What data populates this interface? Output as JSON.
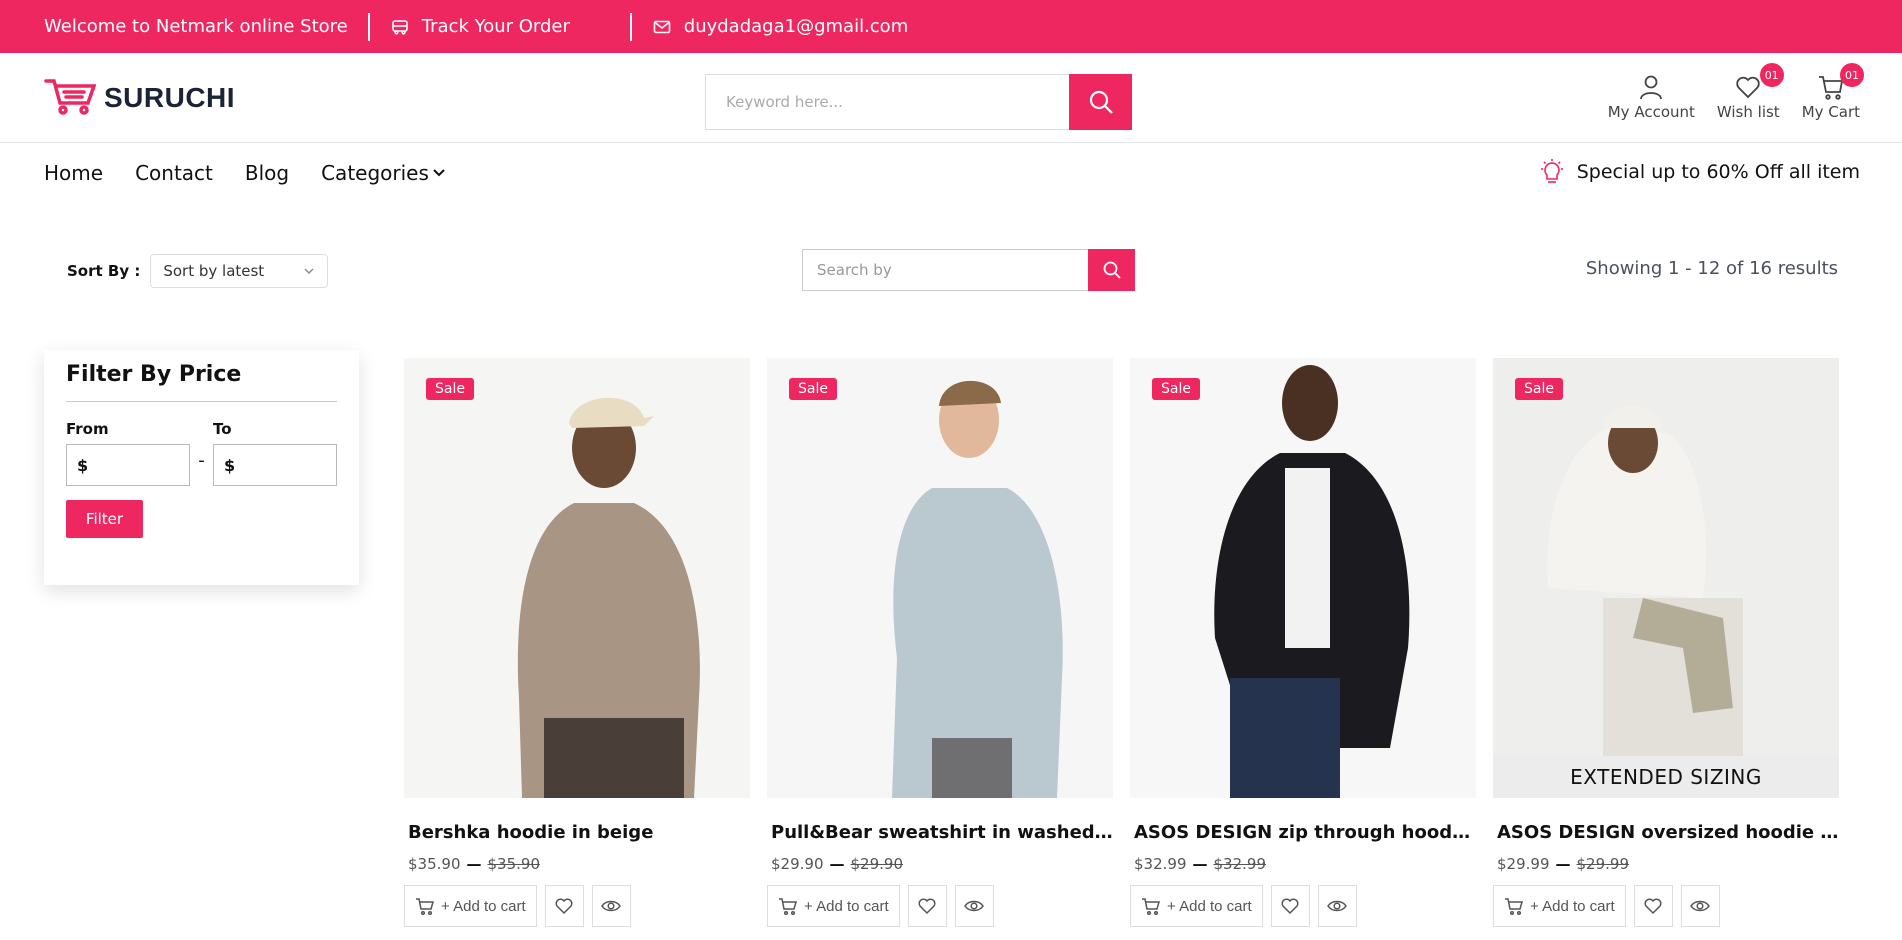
{
  "topbar": {
    "welcome": "Welcome to Netmark online Store",
    "track": "Track Your Order",
    "email": "duydadaga1@gmail.com"
  },
  "header": {
    "logo": "SURUCHI",
    "search_placeholder": "Keyword here...",
    "account_label": "My Account",
    "wishlist_label": "Wish list",
    "wishlist_count": "01",
    "cart_label": "My Cart",
    "cart_count": "01"
  },
  "nav": {
    "items": [
      "Home",
      "Contact",
      "Blog",
      "Categories"
    ],
    "promo": "Special up to 60% Off all item"
  },
  "toolbar": {
    "sort_label": "Sort By :",
    "sort_value": "Sort by latest",
    "search_placeholder": "Search by",
    "results": "Showing 1 - 12 of 16 results"
  },
  "filter": {
    "title": "Filter By Price",
    "from_label": "From",
    "to_label": "To",
    "currency": "$",
    "dash": "-",
    "button": "Filter"
  },
  "products": [
    {
      "name": "Bershka hoodie in beige",
      "price": "$35.90",
      "old_price": "$35.90",
      "badge": "Sale",
      "add_label": "+ Add to cart"
    },
    {
      "name": "Pull&Bear sweatshirt in washed blue",
      "price": "$29.90",
      "old_price": "$29.90",
      "badge": "Sale",
      "add_label": "+ Add to cart"
    },
    {
      "name": "ASOS DESIGN zip through hoodie in ...",
      "price": "$32.99",
      "old_price": "$32.99",
      "badge": "Sale",
      "add_label": "+ Add to cart"
    },
    {
      "name": "ASOS DESIGN oversized hoodie in wh...",
      "price": "$29.99",
      "old_price": "$29.99",
      "badge": "Sale",
      "add_label": "+ Add to cart",
      "image_caption": "EXTENDED SIZING"
    }
  ],
  "colors": {
    "accent": "#ee2761",
    "hoodie_beige": "#a89584",
    "sweat_blue": "#b9c9cf",
    "hoodie_black": "#1a1a1f",
    "hoodie_white": "#f0eeeb"
  }
}
